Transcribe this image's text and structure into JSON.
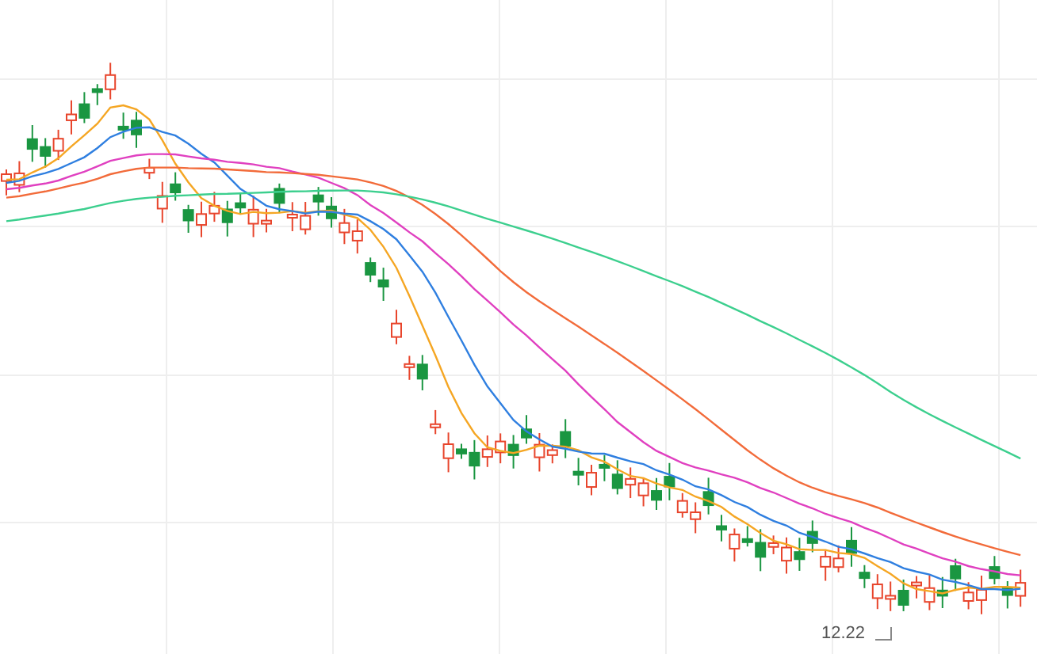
{
  "chart": {
    "price_label": "12.22"
  }
}
